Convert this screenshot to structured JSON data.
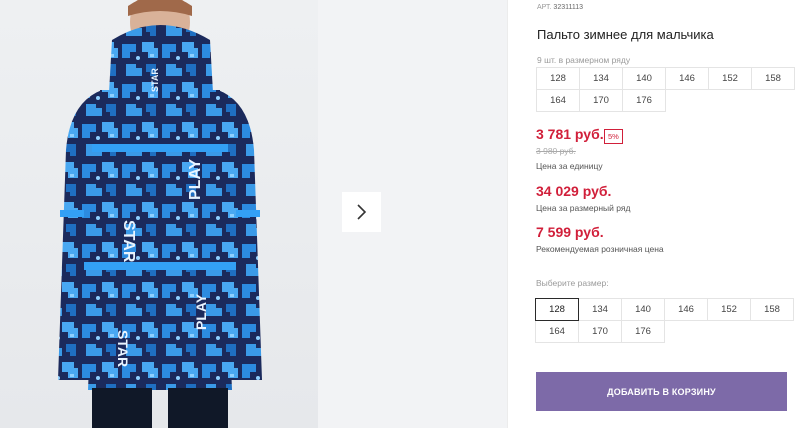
{
  "product": {
    "art_label": "АРТ.",
    "art_number": "32311113",
    "title": "Пальто зимнее для мальчика",
    "image_alt": "Пальто зимнее для мальчика — вид сзади"
  },
  "pack": {
    "note": "9 шт. в размерном ряду",
    "sizes": [
      "128",
      "134",
      "140",
      "146",
      "152",
      "158",
      "164",
      "170",
      "176"
    ]
  },
  "pricing": {
    "unit_price": "3 781 руб.",
    "discount": "5%",
    "old_price": "3 980 руб.",
    "unit_label": "Цена за единицу",
    "row_price": "34 029 руб.",
    "row_label": "Цена за размерный ряд",
    "retail_price": "7 599 руб.",
    "retail_label": "Рекомендуемая розничная цена"
  },
  "size_picker": {
    "label": "Выберите размер:",
    "options": [
      "128",
      "134",
      "140",
      "146",
      "152",
      "158",
      "164",
      "170",
      "176"
    ],
    "selected": "128"
  },
  "cart": {
    "button_label": "ДОБАВИТЬ В КОРЗИНУ"
  },
  "colors": {
    "price_red": "#d11f3a",
    "button_purple": "#7d6aa8",
    "coat_navy": "#1b2a5c",
    "coat_blue": "#2c8be0"
  },
  "icons": {
    "next": "chevron-right-icon"
  }
}
